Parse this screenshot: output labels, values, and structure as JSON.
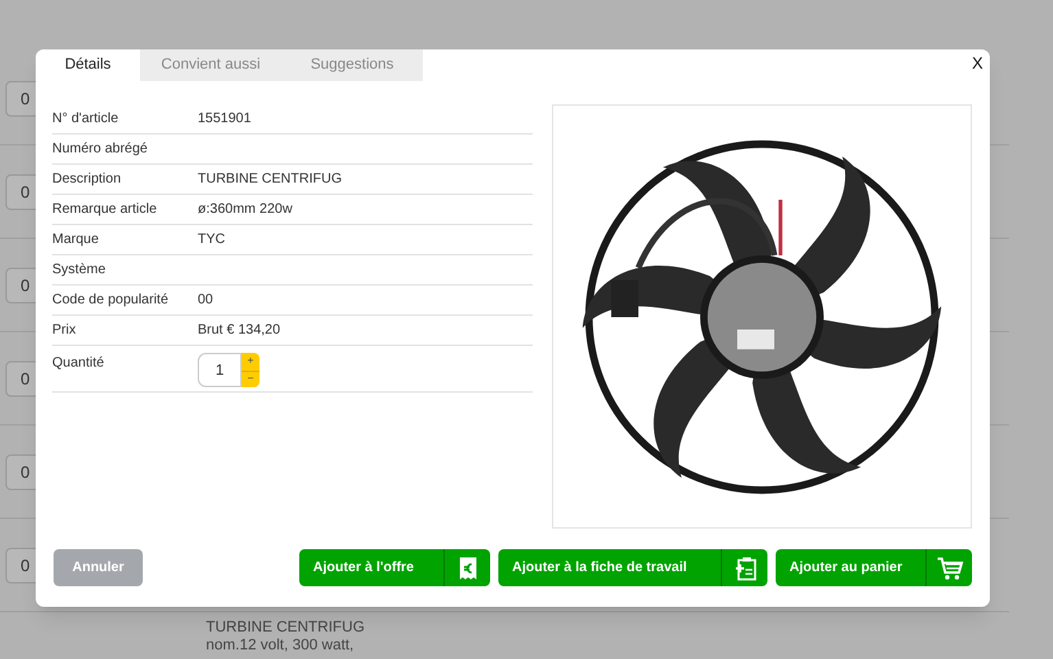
{
  "background": {
    "quantities": [
      "0",
      "0",
      "0",
      "0",
      "0",
      "0"
    ],
    "lines": [
      "TURBINE CENTRIFUG",
      "nom.12 volt, 300 watt,"
    ]
  },
  "dialog": {
    "close": "X",
    "tabs": [
      {
        "label": "Détails",
        "selected": true
      },
      {
        "label": "Convient aussi",
        "selected": false
      },
      {
        "label": "Suggestions",
        "selected": false
      }
    ],
    "details": [
      {
        "label": "N° d'article",
        "value": "1551901"
      },
      {
        "label": "Numéro abrégé"
      },
      {
        "label": "Description",
        "value": "TURBINE CENTRIFUG"
      },
      {
        "label": "Remarque article",
        "value": "ø:360mm 220w"
      },
      {
        "label": "Marque",
        "value": "TYC"
      },
      {
        "label": "Système"
      },
      {
        "label": "Code de popularité",
        "value": "00"
      },
      {
        "label": "Prix",
        "value": "Brut € 134,20"
      }
    ],
    "quantity": {
      "label": "Quantité",
      "value": "1",
      "plus": "+",
      "minus": "−"
    },
    "cancel": "Annuler",
    "actions": [
      {
        "label": "Ajouter à l'offre",
        "kind": "offer"
      },
      {
        "label": "Ajouter à la fiche de travail",
        "kind": "worksheet"
      },
      {
        "label": "Ajouter au panier",
        "kind": "cart"
      }
    ]
  }
}
